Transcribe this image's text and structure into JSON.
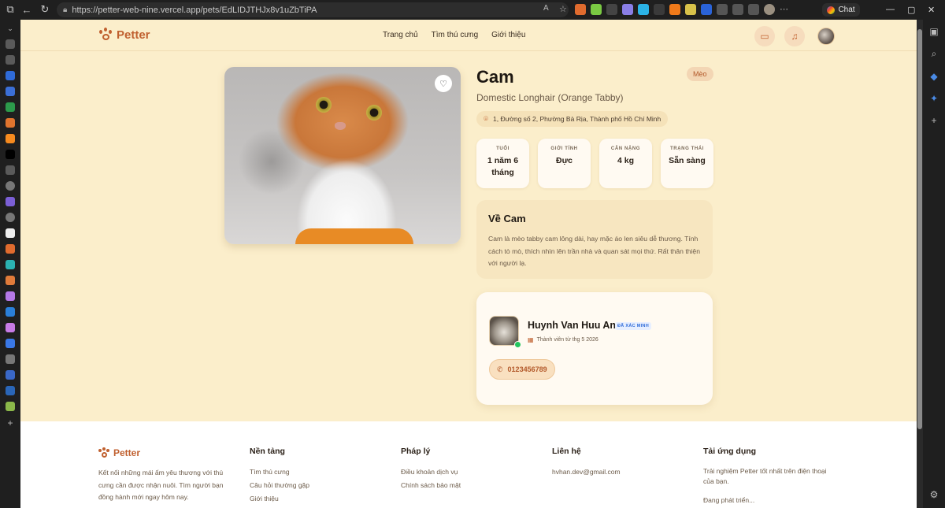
{
  "browser": {
    "url": "https://petter-web-nine.vercel.app/pets/EdLIDJTHJx8v1uZbTiPA",
    "chat_label": "Chat"
  },
  "nav": {
    "brand": "Petter",
    "links": [
      "Trang chủ",
      "Tìm thú cưng",
      "Giới thiệu"
    ]
  },
  "pet": {
    "name": "Cam",
    "species": "Mèo",
    "breed": "Domestic Longhair (Orange Tabby)",
    "location": "1, Đường số 2, Phường Bà Rịa, Thành phố Hồ Chí Minh",
    "stats": [
      {
        "label": "TUỔI",
        "value": "1 năm 6 tháng"
      },
      {
        "label": "GIỚI TÍNH",
        "value": "Đực"
      },
      {
        "label": "CÂN NẶNG",
        "value": "4 kg"
      },
      {
        "label": "TRẠNG THÁI",
        "value": "Sẵn sàng"
      }
    ],
    "about_title": "Về Cam",
    "about_text": "Cam là mèo tabby cam lông dài, hay mặc áo len siêu dễ thương. Tính cách tò mò, thích nhìn lên trần nhà và quan sát mọi thứ. Rất thân thiện với người lạ."
  },
  "owner": {
    "name": "Huynh Van Huu An",
    "verified": "ĐÃ XÁC MINH",
    "member_since": "Thành viên từ thg 5 2026",
    "phone": "0123456789"
  },
  "footer": {
    "brand": "Petter",
    "description": "Kết nối những mái ấm yêu thương với thú cưng cần được nhận nuôi. Tìm người bạn đồng hành mới ngay hôm nay.",
    "platform": {
      "title": "Nền tảng",
      "items": [
        "Tìm thú cưng",
        "Câu hỏi thường gặp",
        "Giới thiệu"
      ]
    },
    "legal": {
      "title": "Pháp lý",
      "items": [
        "Điều khoản dịch vụ",
        "Chính sách bảo mật"
      ]
    },
    "contact": {
      "title": "Liên hệ",
      "email": "hvhan.dev@gmail.com"
    },
    "app": {
      "title": "Tải ứng dụng",
      "desc": "Trải nghiệm Petter tốt nhất trên điện thoại của bạn.",
      "status": "Đang phát triển..."
    }
  }
}
